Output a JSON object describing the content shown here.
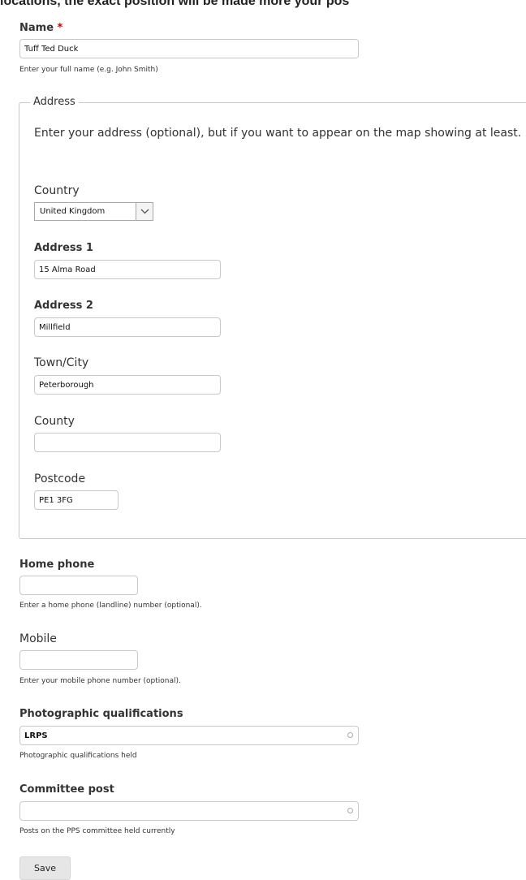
{
  "page": {
    "clipped_heading": "locations, the exact position will be made more your pos"
  },
  "name": {
    "label": "Name",
    "required_mark": "*",
    "value": "Tuff Ted Duck",
    "help": "Enter your full name (e.g. John Smith)"
  },
  "address": {
    "legend": "Address",
    "intro": "Enter your address (optional), but if you want to appear on the map showing at least.",
    "country": {
      "label": "Country",
      "selected": "United Kingdom"
    },
    "address1": {
      "label": "Address 1",
      "value": "15 Alma Road"
    },
    "address2": {
      "label": "Address 2",
      "value": "Millfield"
    },
    "town": {
      "label": "Town/City",
      "value": "Peterborough"
    },
    "county": {
      "label": "County",
      "value": ""
    },
    "postcode": {
      "label": "Postcode",
      "value": "PE1 3FG"
    }
  },
  "home_phone": {
    "label": "Home phone",
    "value": "",
    "help": "Enter a home phone (landline) number (optional)."
  },
  "mobile": {
    "label": "Mobile",
    "value": "",
    "help": "Enter your mobile phone number (optional)."
  },
  "qualifications": {
    "label": "Photographic qualifications",
    "value": "LRPS",
    "help": "Photographic qualifications held"
  },
  "committee": {
    "label": "Committee post",
    "value": "",
    "help": "Posts on the PPS committee held currently"
  },
  "actions": {
    "save_label": "Save"
  }
}
